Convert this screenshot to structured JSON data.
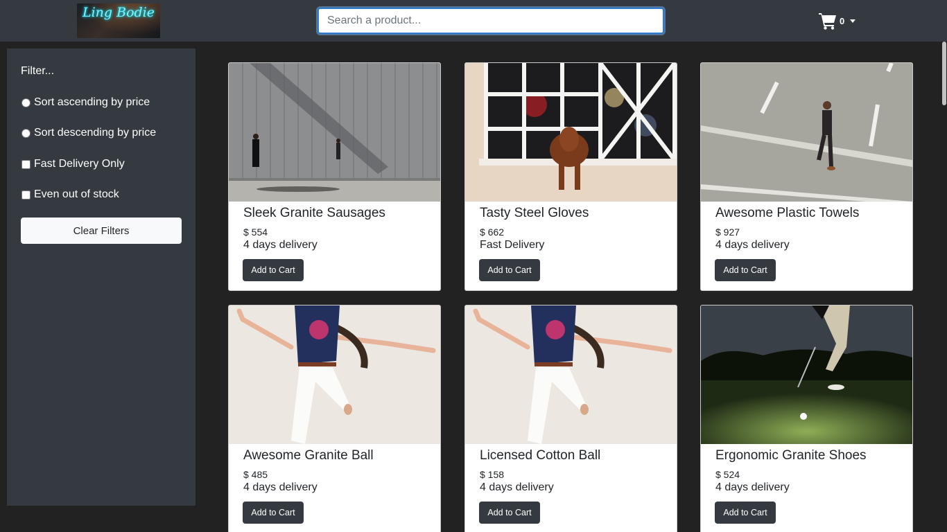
{
  "header": {
    "logo_text": "Ling Bodie",
    "search_placeholder": "Search a product...",
    "cart_count": "0",
    "cart_icon": "shopping-cart-icon",
    "dropdown_icon": "caret-down-icon"
  },
  "sidebar": {
    "title": "Filter...",
    "sort_ascending": "Sort ascending by price",
    "sort_descending": "Sort descending by price",
    "fast_delivery": "Fast Delivery Only",
    "out_of_stock": "Even out of stock",
    "clear_button": "Clear Filters"
  },
  "products": [
    {
      "name": "Sleek Granite Sausages",
      "price": "$ 554",
      "delivery": "4 days delivery",
      "button": "Add to Cart",
      "image": "warehouse-street-photo"
    },
    {
      "name": "Tasty Steel Gloves",
      "price": "$ 662",
      "delivery": "Fast Delivery",
      "button": "Add to Cart",
      "image": "dachshund-window-photo"
    },
    {
      "name": "Awesome Plastic Towels",
      "price": "$ 927",
      "delivery": "4 days delivery",
      "button": "Add to Cart",
      "image": "man-walking-road-photo"
    },
    {
      "name": "Awesome Granite Ball",
      "price": "$ 485",
      "delivery": "4 days delivery",
      "button": "Add to Cart",
      "image": "jumping-woman-photo"
    },
    {
      "name": "Licensed Cotton Ball",
      "price": "$ 158",
      "delivery": "4 days delivery",
      "button": "Add to Cart",
      "image": "jumping-woman-photo"
    },
    {
      "name": "Ergonomic Granite Shoes",
      "price": "$ 524",
      "delivery": "4 days delivery",
      "button": "Add to Cart",
      "image": "night-golf-photo"
    }
  ],
  "colors": {
    "navbar": "#343a40",
    "page_background": "#222222",
    "search_focus_border": "#2d7bd1",
    "button_dark": "#343a40",
    "button_light": "#f8f9fa"
  }
}
